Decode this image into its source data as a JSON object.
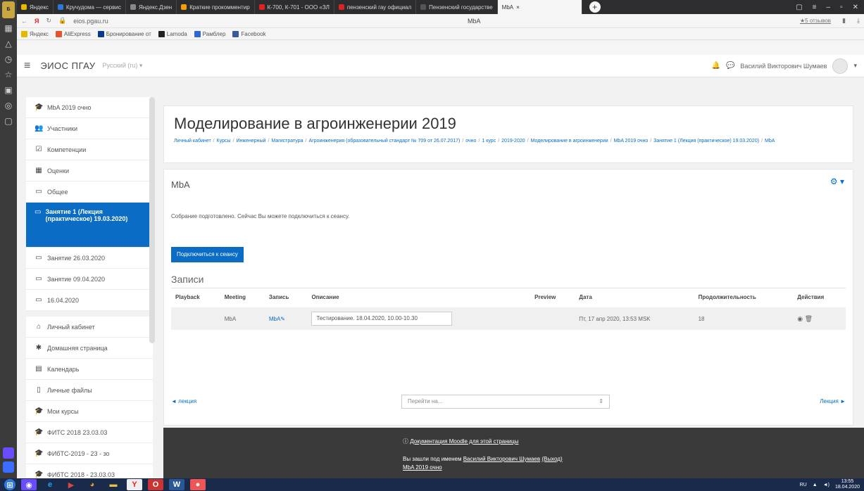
{
  "browser": {
    "tabs": [
      {
        "label": "Яндекс",
        "color": "#e6b800"
      },
      {
        "label": "Кручудома — сервис",
        "color": "#2b78d8"
      },
      {
        "label": "Яндекс.Дзен",
        "color": "#888888"
      },
      {
        "label": "Краткие прокомментир",
        "color": "#f29f05"
      },
      {
        "label": "К-700, К-701 - ООО «ЗЛ",
        "color": "#d22"
      },
      {
        "label": "пензенский гау официал",
        "color": "#d22"
      },
      {
        "label": "Пензенский государстве",
        "color": "#555555"
      }
    ],
    "active_tab": "MbA",
    "url": "eios.pgau.ru",
    "page_title": "MbA",
    "download_label": "★5 отзывов",
    "bookmarks": [
      {
        "label": "Яндекс",
        "color": "#e6b800"
      },
      {
        "label": "AliExpress",
        "color": "#e5542e"
      },
      {
        "label": "Бронирование от",
        "color": "#0b3a8c"
      },
      {
        "label": "Lamoda",
        "color": "#222222"
      },
      {
        "label": "Рамблер",
        "color": "#3066d6"
      },
      {
        "label": "Facebook",
        "color": "#3b5998"
      }
    ]
  },
  "navbar": {
    "brand": "ЭИОС ПГАУ",
    "lang": "Русский (ru) ▾",
    "user_name": "Василий Викторович Шумаев"
  },
  "drawer": {
    "items": [
      {
        "icon": "🎓",
        "label": "MbA 2019 очно"
      },
      {
        "icon": "👥",
        "label": "Участники"
      },
      {
        "icon": "☑",
        "label": "Компетенции"
      },
      {
        "icon": "▦",
        "label": "Оценки"
      },
      {
        "icon": "▭",
        "label": "Общее"
      },
      {
        "icon": "▭",
        "label": "Занятие 1 (Лекция (практическое) 19.03.2020)",
        "active": true
      },
      {
        "icon": "▭",
        "label": "Занятие 26.03.2020"
      },
      {
        "icon": "▭",
        "label": "Занятие 09.04.2020"
      },
      {
        "icon": "▭",
        "label": "16.04.2020"
      }
    ],
    "items2": [
      {
        "icon": "⌂",
        "label": "Личный кабинет"
      },
      {
        "icon": "✱",
        "label": "Домашняя страница"
      },
      {
        "icon": "▤",
        "label": "Календарь"
      },
      {
        "icon": "▯",
        "label": "Личные файлы"
      },
      {
        "icon": "🎓",
        "label": "Мои курсы"
      },
      {
        "icon": "🎓",
        "label": "ФИТС 2018 23.03.03"
      },
      {
        "icon": "🎓",
        "label": "ФИбТС-2019 - 23 - зо"
      },
      {
        "icon": "🎓",
        "label": "ФИбТС 2018 - 23.03.03"
      }
    ]
  },
  "header": {
    "title": "Моделирование в агроинженерии 2019",
    "breadcrumbs": [
      "Личный кабинет",
      "Курсы",
      "Инженерный",
      "Магистратура",
      "Агроинженерия (образовательный стандарт № 709 от 26.07.2017)",
      "очно",
      "1 курс",
      "2019-2020",
      "Моделирование в агроинженерии",
      "MbA 2019 очно",
      "Занятие 1 (Лекция (практическое) 19.03.2020)",
      "MbA"
    ]
  },
  "content": {
    "title": "MbA",
    "status": "Собрание подготовлено. Сейчас Вы можете подключиться к сеансу.",
    "join_label": "Подключиться к сеансу",
    "recordings_title": "Записи",
    "table": {
      "headers": [
        "Playback",
        "Meeting",
        "Запись",
        "Описание",
        "Preview",
        "Дата",
        "Продолжительность",
        "Действия"
      ],
      "rows": [
        {
          "playback": "",
          "meeting": "MbA",
          "record": "MbA",
          "description": "Тестирование. 18.04.2020, 10.00-10.30",
          "preview": "",
          "date": "Пт, 17 апр 2020, 13:53 MSK",
          "duration": "18"
        }
      ]
    },
    "prev_label": "◄ лекция",
    "jump_placeholder": "Перейти на...",
    "next_label": "Лекция ►"
  },
  "footer": {
    "doc_link": "Документация Moodle для этой страницы",
    "login_prefix": "Вы зашли под именем",
    "login_name": "Василий Викторович Шумаев",
    "logout": "(Выход)",
    "course": "MbA 2019 очно"
  },
  "taskbar": {
    "clock": "13:55",
    "date": "18.04.2020",
    "lang": "RU"
  }
}
